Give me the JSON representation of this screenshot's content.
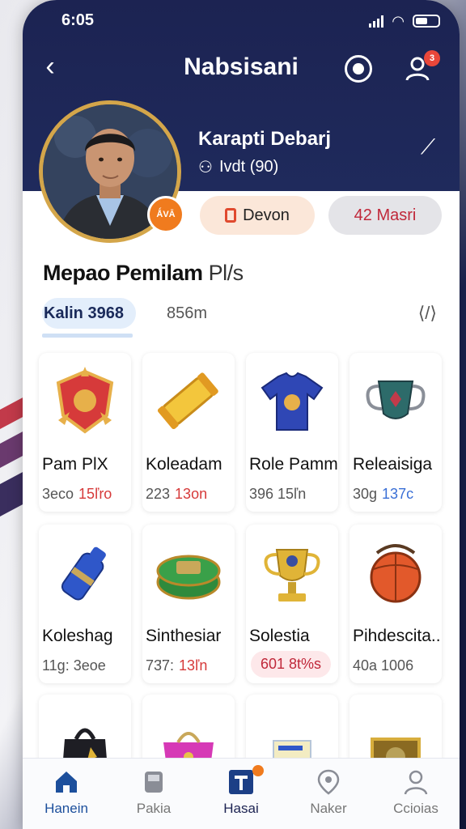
{
  "status_bar": {
    "time": "6:05"
  },
  "nav": {
    "title": "Nabsisani",
    "notification_count": "3"
  },
  "profile": {
    "name": "Karapti Debarj",
    "subtitle": "Ivdt (90)",
    "avatar_badge": "ǺVĀ",
    "pill_left": "Devon",
    "pill_right": "42 Masri"
  },
  "section": {
    "title": "Mepao Pemilam",
    "title_suffix": "Pl/s"
  },
  "filters": {
    "chip": "Kalin 3968",
    "sort": "856m",
    "arrow": "⟨/⟩"
  },
  "items": [
    {
      "name": "Pam PlX",
      "meta": "3eco",
      "meta_accent": "15ľro",
      "icon": "red-shield-icon",
      "accent_color": "#d63a3a"
    },
    {
      "name": "Koleadam",
      "meta": "223",
      "meta_accent": "13on",
      "icon": "gold-scroll-icon",
      "accent_color": "#d63a3a"
    },
    {
      "name": "Role Pamm",
      "meta": "396 15ľn",
      "meta_accent": "",
      "icon": "jersey-icon",
      "accent_color": "#555555"
    },
    {
      "name": "Releaisiga",
      "meta": "30g",
      "meta_accent": "137c",
      "icon": "trophy-cup-icon",
      "accent_color": "#3a6fd6"
    },
    {
      "name": "Koleshag",
      "meta": "11g: 3eoe",
      "meta_accent": "",
      "icon": "blue-bottle-icon",
      "accent_color": "#555555"
    },
    {
      "name": "Sinthesiar",
      "meta": "73̈7:",
      "meta_accent": "13ľn",
      "icon": "green-chest-icon",
      "accent_color": "#d63a3a"
    },
    {
      "name": "Solestia",
      "meta": "601 8t%s",
      "meta_accent": "",
      "icon": "gold-trophy-icon",
      "accent_color": "#c0283a"
    },
    {
      "name": "Pihdescita..",
      "meta": "40a 1006",
      "meta_accent": "",
      "icon": "orange-ball-icon",
      "accent_color": "#555555"
    },
    {
      "name": "",
      "meta": "",
      "meta_accent": "",
      "icon": "black-bag-icon",
      "accent_color": "#555555"
    },
    {
      "name": "",
      "meta": "",
      "meta_accent": "",
      "icon": "pink-bag-icon",
      "accent_color": "#555555"
    },
    {
      "name": "",
      "meta": "",
      "meta_accent": "",
      "icon": "box-icon",
      "accent_color": "#555555"
    },
    {
      "name": "",
      "meta": "",
      "meta_accent": "",
      "icon": "gold-frame-icon",
      "accent_color": "#555555"
    }
  ],
  "tabs": [
    {
      "label": "Hanein",
      "icon": "home-icon"
    },
    {
      "label": "Pakia",
      "icon": "device-icon"
    },
    {
      "label": "Hasai",
      "icon": "t-square-icon"
    },
    {
      "label": "Naker",
      "icon": "location-pin-icon"
    },
    {
      "label": "Ccioias",
      "icon": "person-icon"
    }
  ],
  "colors": {
    "header_bg": "#1c2352",
    "accent_orange": "#f07b1e",
    "accent_red": "#d63a3a",
    "active_tab": "#1c4f9c"
  }
}
